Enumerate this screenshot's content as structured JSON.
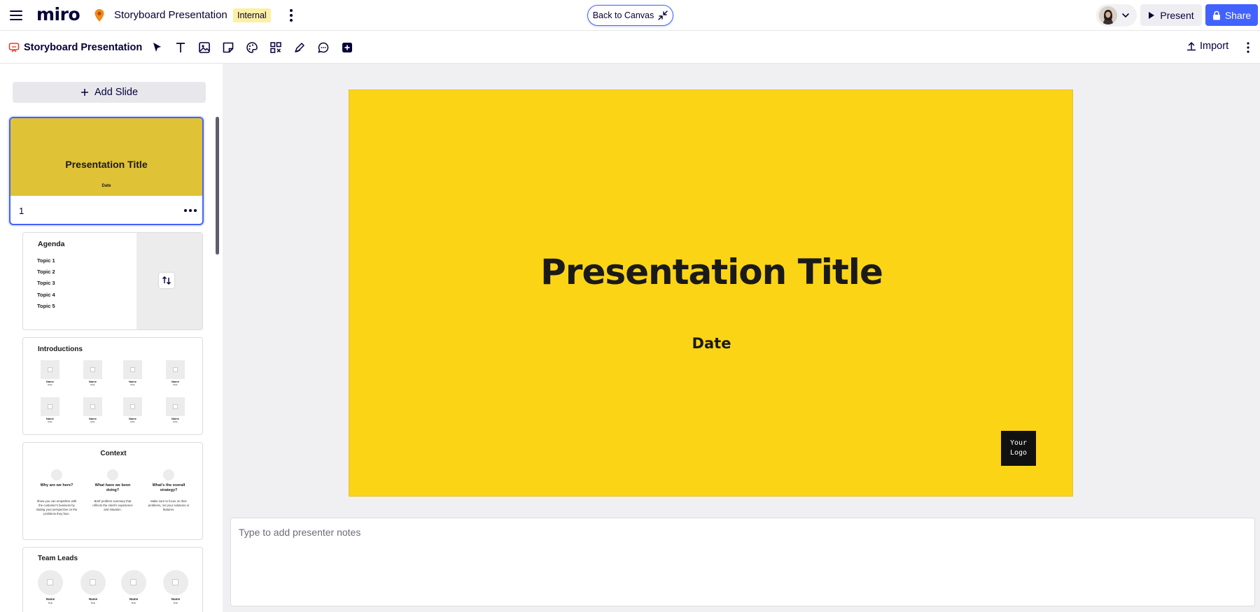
{
  "topbar": {
    "logo": "miro",
    "board_title": "Storyboard Presentation",
    "badge": "Internal",
    "back_to_canvas": "Back to Canvas",
    "present": "Present",
    "share": "Share"
  },
  "toolbar": {
    "presentation_title": "Storyboard Presentation",
    "tools": [
      "select-arrow-icon",
      "text-icon",
      "image-icon",
      "sticky-note-icon",
      "palette-icon",
      "frames-icon",
      "pen-icon",
      "comment-icon",
      "plus-square-icon"
    ],
    "import": "Import"
  },
  "sidebar": {
    "add_slide": "Add Slide",
    "slide1": {
      "title": "Presentation Title",
      "date": "Date",
      "number": "1"
    },
    "slide2": {
      "title": "Agenda",
      "topics": [
        "Topic 1",
        "Topic 2",
        "Topic 3",
        "Topic 4",
        "Topic 5"
      ]
    },
    "slide3": {
      "title": "Introductions",
      "name": "Name",
      "role": "Role"
    },
    "slide4": {
      "title": "Context",
      "columns": [
        {
          "heading": "Why are we here?",
          "text": "Show you can empathize with the customer's business by stating your perspective on the problems they face."
        },
        {
          "heading": "What have we been doing?",
          "text": "Brief problem summary that reflects the client's experience and situation."
        },
        {
          "heading": "What's the overall strategy?",
          "text": "Make sure to focus on their problems, not your solutions or features."
        }
      ]
    },
    "slide5": {
      "title": "Team Leads",
      "name": "Name",
      "role": "Role"
    }
  },
  "slide": {
    "title": "Presentation Title",
    "date": "Date",
    "logo": "Your\nLogo",
    "background": "#fcd416"
  },
  "notes": {
    "placeholder": "Type to add presenter notes"
  },
  "colors": {
    "accent": "#4262ff",
    "slide_bg": "#fcd416",
    "badge_bg": "#fbf0a3"
  }
}
